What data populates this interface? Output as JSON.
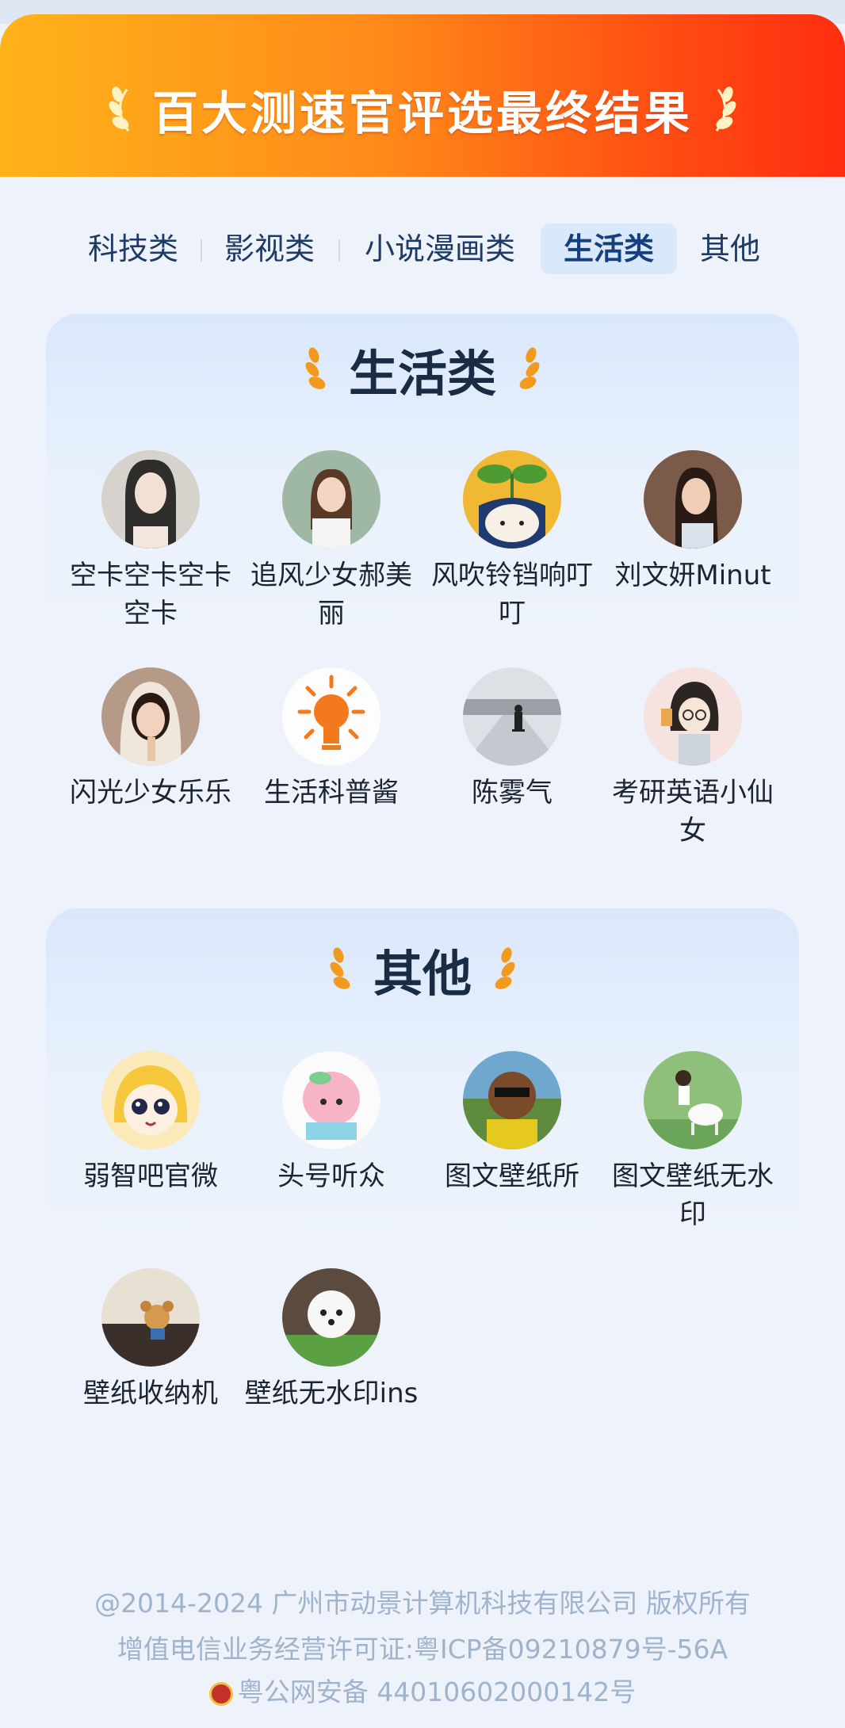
{
  "banner": {
    "title": "百大测速官评选最终结果"
  },
  "tabs": [
    {
      "label": "科技类"
    },
    {
      "label": "影视类"
    },
    {
      "label": "小说漫画类"
    },
    {
      "label": "生活类",
      "active": true
    },
    {
      "label": "其他"
    }
  ],
  "sections": [
    {
      "title": "生活类",
      "items": [
        {
          "name": "空卡空卡空卡空卡",
          "avatar": "woman-portrait"
        },
        {
          "name": "追风少女郝美丽",
          "avatar": "woman-outdoor"
        },
        {
          "name": "风吹铃铛响叮叮",
          "avatar": "sprout-cartoon"
        },
        {
          "name": "刘文妍Minut",
          "avatar": "woman-smiling"
        },
        {
          "name": "闪光少女乐乐",
          "avatar": "girl-hood"
        },
        {
          "name": "生活科普酱",
          "avatar": "lightbulb-icon"
        },
        {
          "name": "陈雾气",
          "avatar": "person-snow"
        },
        {
          "name": "考研英语小仙女",
          "avatar": "cartoon-girl-glasses"
        }
      ]
    },
    {
      "title": "其他",
      "items": [
        {
          "name": "弱智吧官微",
          "avatar": "anime-girl"
        },
        {
          "name": "头号听众",
          "avatar": "peach-cartoon"
        },
        {
          "name": "图文壁纸所",
          "avatar": "sunglasses-cartoon"
        },
        {
          "name": "图文壁纸无水印",
          "avatar": "girl-goat-cartoon"
        },
        {
          "name": "壁纸收纳机",
          "avatar": "teddy-bear"
        },
        {
          "name": "壁纸无水印ins",
          "avatar": "white-dog"
        }
      ]
    }
  ],
  "footer": {
    "line1": "@2014-2024 广州市动景计算机科技有限公司 版权所有",
    "line2": "增值电信业务经营许可证:粤ICP备09210879号-56A",
    "line3": "粤公网安备 44010602000142号"
  },
  "colors": {
    "banner_start": "#ffb31a",
    "banner_end": "#ff2d10",
    "accent": "#f29a1f",
    "tab_active_bg": "#d9e8fb"
  }
}
